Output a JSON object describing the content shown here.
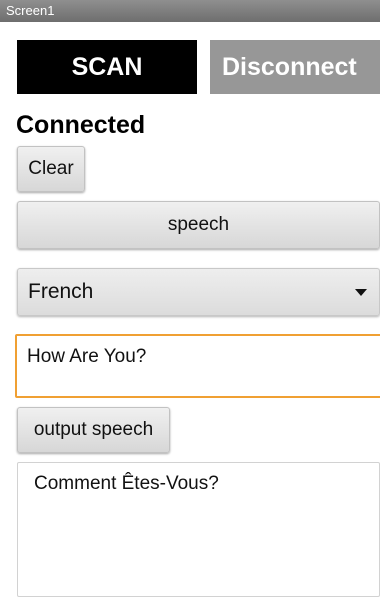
{
  "app": {
    "title": "Screen1"
  },
  "buttons": {
    "scan": "SCAN",
    "disconnect": "Disconnect",
    "clear": "Clear",
    "speech": "speech",
    "output_speech": "output speech"
  },
  "status": {
    "text": "Connected"
  },
  "language_select": {
    "selected": "French"
  },
  "input": {
    "value": "How Are You?"
  },
  "output": {
    "text": "Comment Êtes-Vous?"
  },
  "colors": {
    "scan_bg": "#000000",
    "disconnect_bg": "#979797",
    "input_focus_border": "#f0a033"
  }
}
